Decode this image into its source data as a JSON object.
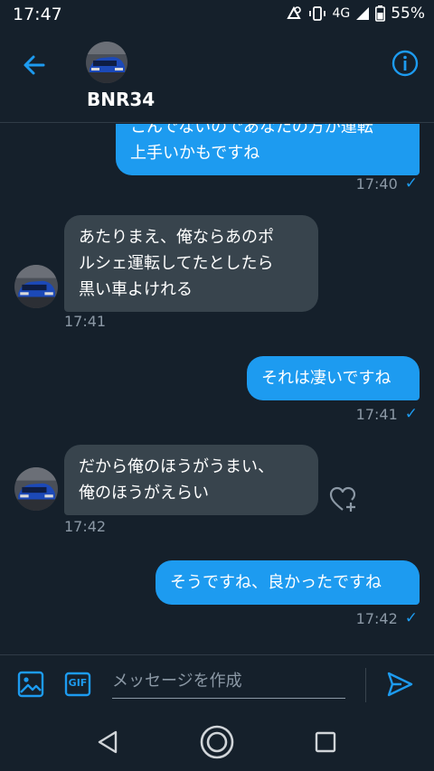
{
  "status_bar": {
    "time": "17:47",
    "network": "4G",
    "battery": "55%"
  },
  "header": {
    "contact_name": "BNR34",
    "back_icon": "back-arrow-icon",
    "info_icon": "info-icon"
  },
  "messages": [
    {
      "direction": "out",
      "lines": [
        "こんでないのであなたの方が運転",
        "上手いかもですね"
      ],
      "time": "17:40",
      "read": true
    },
    {
      "direction": "in",
      "lines": [
        "あたりまえ、俺ならあのポ",
        "ルシェ運転してたとしたら",
        "黒い車よけれる"
      ],
      "time": "17:41"
    },
    {
      "direction": "out",
      "lines": [
        "それは凄いですね"
      ],
      "time": "17:41",
      "read": true
    },
    {
      "direction": "in",
      "lines": [
        "だから俺のほうがうまい、",
        "俺のほうがえらい"
      ],
      "time": "17:42"
    },
    {
      "direction": "out",
      "lines": [
        "そうですね、良かったですね"
      ],
      "time": "17:42",
      "read": true
    }
  ],
  "composer": {
    "placeholder": "メッセージを作成",
    "gif_label": "GIF"
  },
  "colors": {
    "background": "#15202b",
    "accent": "#1d9bf0",
    "incoming_bubble": "#38444d",
    "muted_text": "#8b98a5"
  }
}
